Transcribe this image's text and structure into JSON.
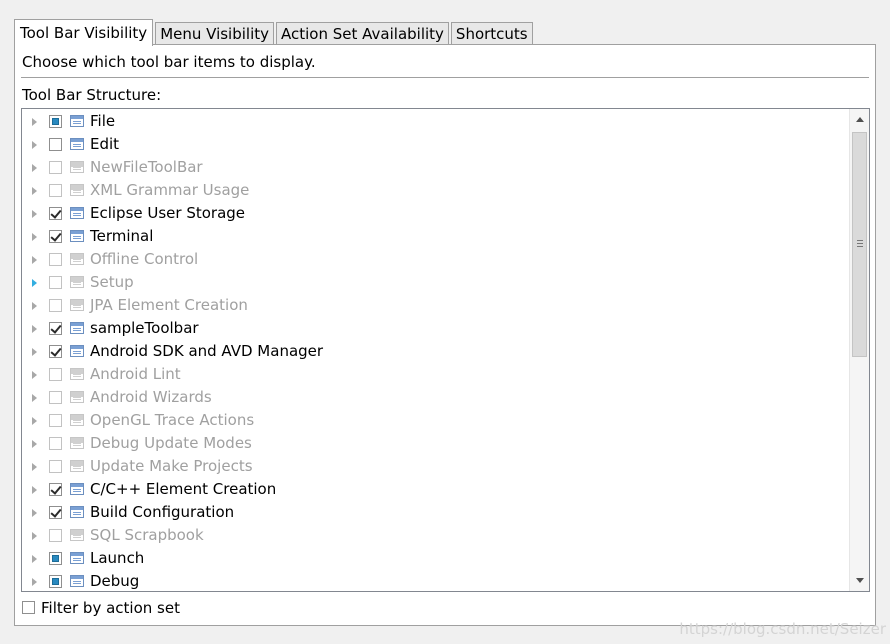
{
  "tabs": [
    {
      "label": "Tool Bar Visibility",
      "active": true
    },
    {
      "label": "Menu Visibility",
      "active": false
    },
    {
      "label": "Action Set Availability",
      "active": false
    },
    {
      "label": "Shortcuts",
      "active": false
    }
  ],
  "description": "Choose which tool bar items to display.",
  "structure_label": "Tool Bar Structure:",
  "tree_items": [
    {
      "label": "File",
      "state": "partial",
      "enabled": true
    },
    {
      "label": "Edit",
      "state": "unchecked",
      "enabled": true
    },
    {
      "label": "NewFileToolBar",
      "state": "unchecked",
      "enabled": false
    },
    {
      "label": "XML Grammar Usage",
      "state": "unchecked",
      "enabled": false
    },
    {
      "label": "Eclipse User Storage",
      "state": "checked",
      "enabled": true
    },
    {
      "label": "Terminal",
      "state": "checked",
      "enabled": true
    },
    {
      "label": "Offline Control",
      "state": "unchecked",
      "enabled": false
    },
    {
      "label": "Setup",
      "state": "unchecked",
      "enabled": false,
      "highlight": true
    },
    {
      "label": "JPA Element Creation",
      "state": "unchecked",
      "enabled": false
    },
    {
      "label": "sampleToolbar",
      "state": "checked",
      "enabled": true
    },
    {
      "label": "Android SDK and AVD Manager",
      "state": "checked",
      "enabled": true
    },
    {
      "label": "Android Lint",
      "state": "unchecked",
      "enabled": false
    },
    {
      "label": "Android Wizards",
      "state": "unchecked",
      "enabled": false
    },
    {
      "label": "OpenGL Trace Actions",
      "state": "unchecked",
      "enabled": false
    },
    {
      "label": "Debug Update Modes",
      "state": "unchecked",
      "enabled": false
    },
    {
      "label": "Update Make Projects",
      "state": "unchecked",
      "enabled": false
    },
    {
      "label": "C/C++ Element Creation",
      "state": "checked",
      "enabled": true
    },
    {
      "label": "Build Configuration",
      "state": "checked",
      "enabled": true
    },
    {
      "label": "SQL Scrapbook",
      "state": "unchecked",
      "enabled": false
    },
    {
      "label": "Launch",
      "state": "partial",
      "enabled": true
    },
    {
      "label": "Debug",
      "state": "partial",
      "enabled": true
    }
  ],
  "filter_label": "Filter by action set",
  "filter_checked": false,
  "watermark": "https://blog.csdn.net/Seizer"
}
